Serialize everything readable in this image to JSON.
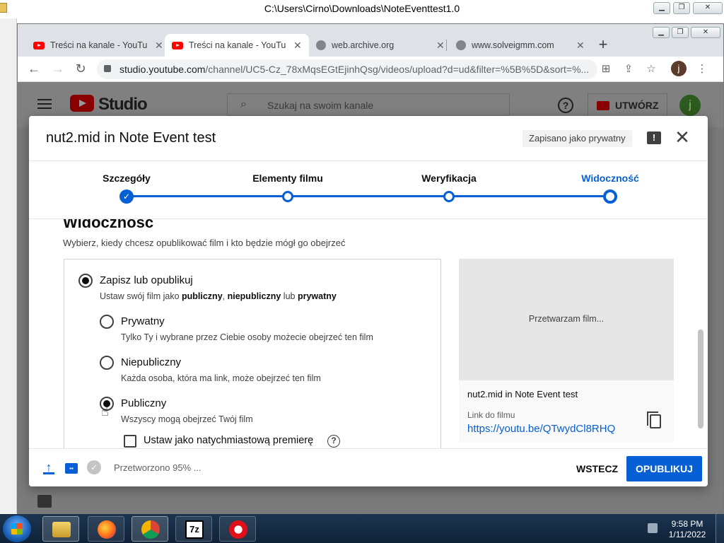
{
  "os_window": {
    "title": "C:\\Users\\Cirno\\Downloads\\NoteEventtest1.0"
  },
  "browser": {
    "tabs": [
      {
        "label": "Treści na kanale - YouTube",
        "icon": "youtube-icon",
        "active": false
      },
      {
        "label": "Treści na kanale - YouTube",
        "icon": "youtube-icon",
        "active": true
      },
      {
        "label": "web.archive.org",
        "icon": "globe-icon",
        "active": false
      },
      {
        "label": "www.solveigmm.com",
        "icon": "globe-icon",
        "active": false
      }
    ],
    "url_host": "studio.youtube.com",
    "url_path": "/channel/UC5-Cz_78xMqsEGtEjinhQsg/videos/upload?d=ud&filter=%5B%5D&sort=%...",
    "profile_initial": "j"
  },
  "studio_header": {
    "logo_text": "Studio",
    "search_placeholder": "Szukaj na swoim kanale",
    "create_label": "UTWÓRZ",
    "avatar_initial": "j"
  },
  "dialog": {
    "title": "nut2.mid in Note Event test",
    "saved_chip": "Zapisano jako prywatny",
    "steps": [
      {
        "label": "Szczegóły",
        "state": "done"
      },
      {
        "label": "Elementy filmu",
        "state": "todo"
      },
      {
        "label": "Weryfikacja",
        "state": "todo"
      },
      {
        "label": "Widoczność",
        "state": "current"
      }
    ],
    "visibility": {
      "heading": "Widoczność",
      "subtitle": "Wybierz, kiedy chcesz opublikować film i kto będzie mógł go obejrzeć",
      "save_publish": {
        "title": "Zapisz lub opublikuj",
        "desc_prefix": "Ustaw swój film jako ",
        "desc_public": "publiczny",
        "desc_comma": ", ",
        "desc_unlisted": "niepubliczny",
        "desc_or": " lub ",
        "desc_private": "prywatny"
      },
      "options": [
        {
          "title": "Prywatny",
          "desc": "Tylko Ty i wybrane przez Ciebie osoby możecie obejrzeć ten film",
          "selected": false
        },
        {
          "title": "Niepubliczny",
          "desc": "Każda osoba, która ma link, może obejrzeć ten film",
          "selected": false
        },
        {
          "title": "Publiczny",
          "desc": "Wszyscy mogą obejrzeć Twój film",
          "selected": true
        }
      ],
      "premiere_label": "Ustaw jako natychmiastową premierę"
    },
    "preview": {
      "processing_text": "Przetwarzam film...",
      "video_name": "nut2.mid in Note Event test",
      "link_label": "Link do filmu",
      "link_url": "https://youtu.be/QTwydCl8RHQ"
    },
    "footer": {
      "status": "Przetworzono 95% ...",
      "back_label": "WSTECZ",
      "publish_label": "OPUBLIKUJ"
    }
  },
  "taskbar": {
    "apps": [
      "explorer",
      "firefox",
      "chrome",
      "7-zip",
      "recorder"
    ],
    "seven_zip_label": "7z",
    "time": "9:58 PM",
    "date": "1/11/2022"
  },
  "colors": {
    "accent": "#065fd4",
    "youtube_red": "#ff0000"
  }
}
